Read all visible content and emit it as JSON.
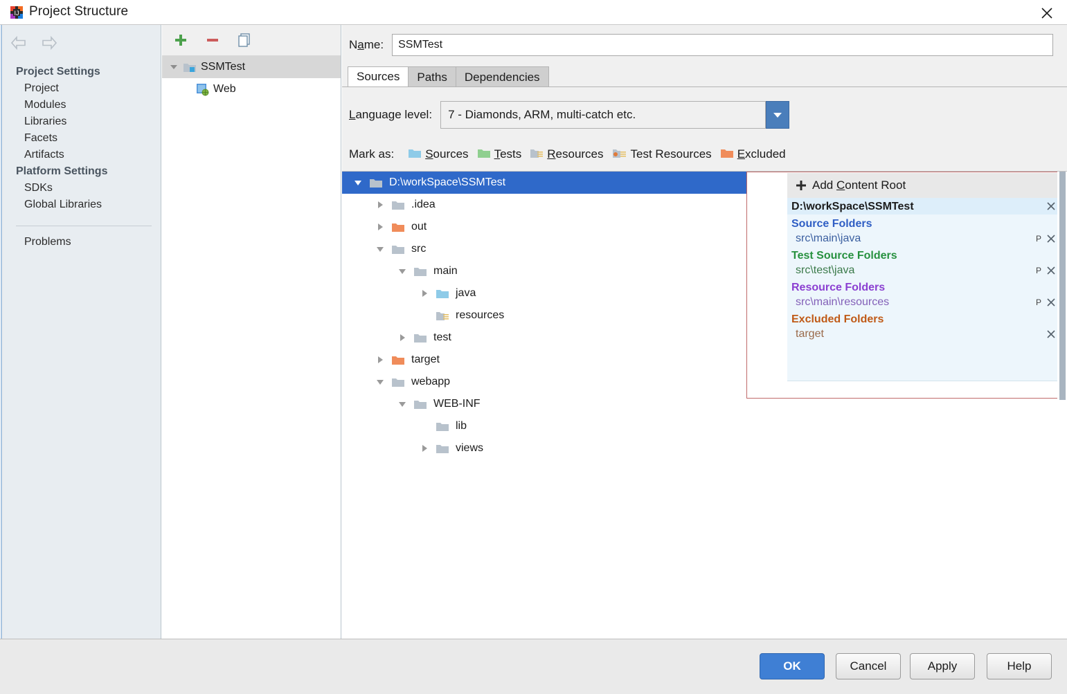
{
  "window": {
    "title": "Project Structure",
    "app_icon": "intellij-idea-icon",
    "close_icon": "close-icon"
  },
  "sidebar": {
    "nav": {
      "back_icon": "back-arrow-icon",
      "forward_icon": "forward-arrow-icon"
    },
    "groups": [
      {
        "label": "Project Settings",
        "items": [
          "Project",
          "Modules",
          "Libraries",
          "Facets",
          "Artifacts"
        ]
      },
      {
        "label": "Platform Settings",
        "items": [
          "SDKs",
          "Global Libraries"
        ]
      }
    ],
    "extra_items": [
      "Problems"
    ]
  },
  "modules_panel": {
    "toolbar": [
      {
        "name": "add-module-button",
        "icon": "plus-icon",
        "label": "+"
      },
      {
        "name": "remove-module-button",
        "icon": "minus-icon",
        "label": "-"
      },
      {
        "name": "copy-module-button",
        "icon": "copy-icon",
        "label": "copy"
      }
    ],
    "tree": [
      {
        "label": "SSMTest",
        "icon": "module-group-folder-icon",
        "expanded": true,
        "selected": true,
        "indent": 0
      },
      {
        "label": "Web",
        "icon": "web-facet-icon",
        "expanded": false,
        "selected": false,
        "indent": 1
      }
    ]
  },
  "detail": {
    "name_label": "Name:",
    "name_value": "SSMTest",
    "tabs": [
      {
        "label": "Sources",
        "active": true
      },
      {
        "label": "Paths",
        "active": false
      },
      {
        "label": "Dependencies",
        "active": false
      }
    ],
    "language_level_label": "Language level:",
    "language_level_value": "7 - Diamonds, ARM, multi-catch etc.",
    "language_level_arrow_icon": "chevron-down-icon",
    "mark_as_label": "Mark as:",
    "mark_as_options": [
      {
        "label": "Sources",
        "color": "#8ecbe8",
        "icon": "sources-folder-icon"
      },
      {
        "label": "Tests",
        "color": "#8fcf8f",
        "icon": "tests-folder-icon"
      },
      {
        "label": "Resources",
        "color": "#b8c2cc",
        "icon": "resources-folder-icon"
      },
      {
        "label": "Test Resources",
        "color": "#b8c2cc",
        "icon": "test-resources-folder-icon"
      },
      {
        "label": "Excluded",
        "color": "#f08c5a",
        "icon": "excluded-folder-icon"
      }
    ]
  },
  "file_tree": [
    {
      "label": "D:\\workSpace\\SSMTest",
      "indent": 0,
      "tri": "down",
      "color": "#b8c2cc",
      "selected": true,
      "icon": "folder-icon"
    },
    {
      "label": ".idea",
      "indent": 1,
      "tri": "right",
      "color": "#b8c2cc",
      "selected": false,
      "icon": "folder-icon"
    },
    {
      "label": "out",
      "indent": 1,
      "tri": "right",
      "color": "#f08c5a",
      "selected": false,
      "icon": "excluded-folder-icon"
    },
    {
      "label": "src",
      "indent": 1,
      "tri": "down",
      "color": "#b8c2cc",
      "selected": false,
      "icon": "folder-icon"
    },
    {
      "label": "main",
      "indent": 2,
      "tri": "down",
      "color": "#b8c2cc",
      "selected": false,
      "icon": "folder-icon"
    },
    {
      "label": "java",
      "indent": 3,
      "tri": "right",
      "color": "#8ecbe8",
      "selected": false,
      "icon": "sources-folder-icon"
    },
    {
      "label": "resources",
      "indent": 3,
      "tri": "none",
      "color": "#b8c2cc",
      "selected": false,
      "icon": "resources-folder-icon"
    },
    {
      "label": "test",
      "indent": 2,
      "tri": "right",
      "color": "#b8c2cc",
      "selected": false,
      "icon": "folder-icon"
    },
    {
      "label": "target",
      "indent": 1,
      "tri": "right",
      "color": "#f08c5a",
      "selected": false,
      "icon": "excluded-folder-icon"
    },
    {
      "label": "webapp",
      "indent": 1,
      "tri": "down",
      "color": "#b8c2cc",
      "selected": false,
      "icon": "folder-icon"
    },
    {
      "label": "WEB-INF",
      "indent": 2,
      "tri": "down",
      "color": "#b8c2cc",
      "selected": false,
      "icon": "folder-icon"
    },
    {
      "label": "lib",
      "indent": 3,
      "tri": "none",
      "color": "#b8c2cc",
      "selected": false,
      "icon": "folder-icon"
    },
    {
      "label": "views",
      "indent": 3,
      "tri": "right",
      "color": "#b8c2cc",
      "selected": false,
      "icon": "folder-icon"
    }
  ],
  "content_roots": {
    "add_label": "Add Content Root",
    "add_icon": "plus-icon",
    "root_path": "D:\\workSpace\\SSMTest",
    "root_remove_icon": "close-icon",
    "groups": [
      {
        "title": "Source Folders",
        "color": "#2f5ec4",
        "items": [
          {
            "path": "src\\main\\java",
            "prefix_btn": "P",
            "remove_icon": "close-icon"
          }
        ]
      },
      {
        "title": "Test Source Folders",
        "color": "#27913f",
        "items": [
          {
            "path": "src\\test\\java",
            "prefix_btn": "P",
            "remove_icon": "close-icon"
          }
        ]
      },
      {
        "title": "Resource Folders",
        "color": "#8b3fd1",
        "items": [
          {
            "path": "src\\main\\resources",
            "prefix_btn": "P",
            "remove_icon": "close-icon"
          }
        ]
      },
      {
        "title": "Excluded Folders",
        "color": "#c05a17",
        "items": [
          {
            "path": "target",
            "prefix_btn": "",
            "remove_icon": "close-icon"
          }
        ]
      }
    ]
  },
  "footer": {
    "buttons": [
      {
        "label": "OK",
        "primary": true
      },
      {
        "label": "Cancel",
        "primary": false
      },
      {
        "label": "Apply",
        "primary": false
      },
      {
        "label": "Help",
        "primary": false
      }
    ]
  }
}
